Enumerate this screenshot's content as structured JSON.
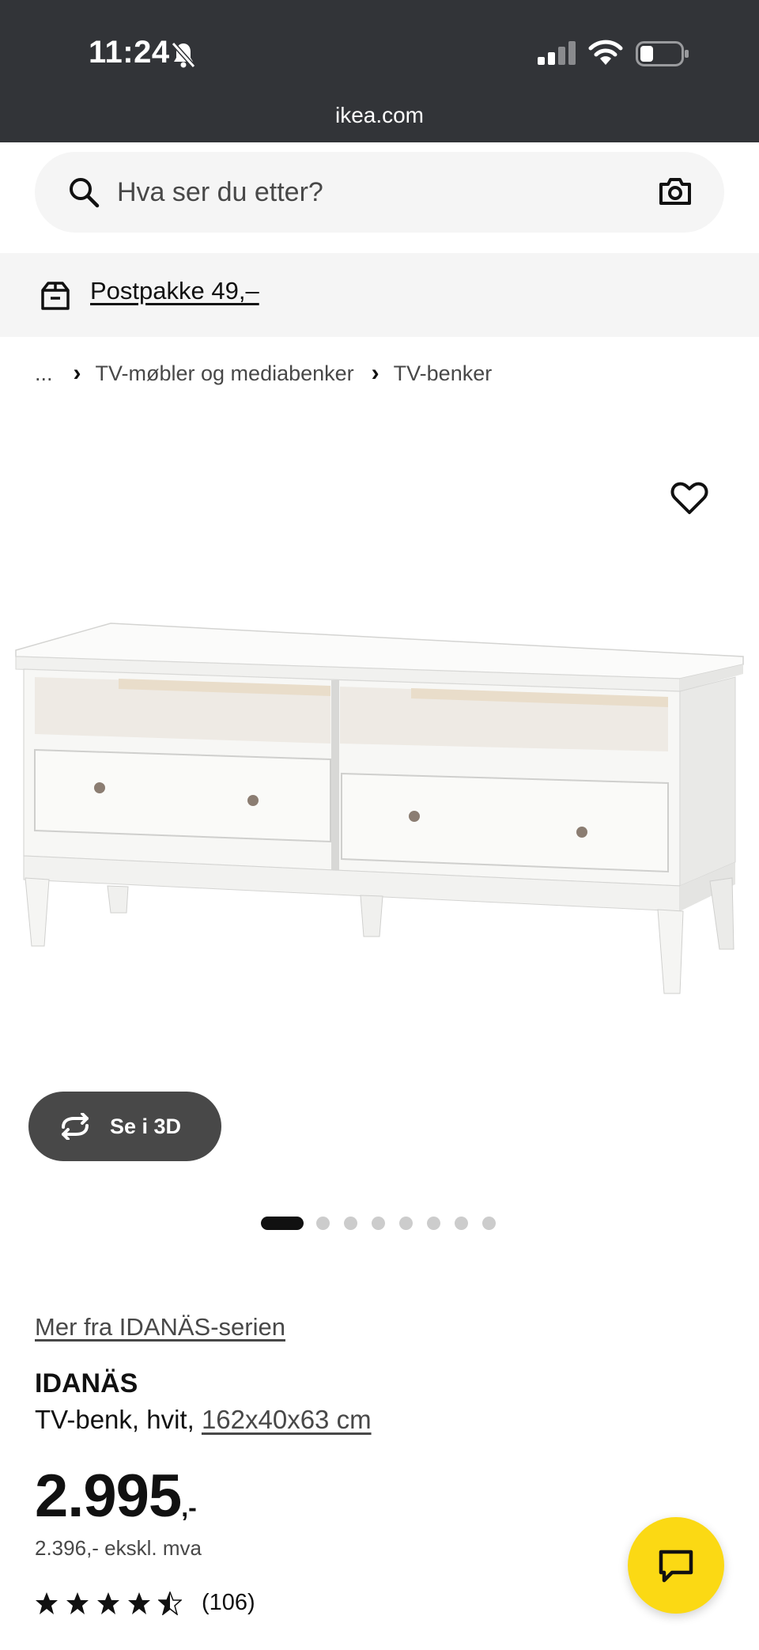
{
  "status_bar": {
    "time": "11:24",
    "icons": [
      "bell-slash-icon",
      "cellular-signal-icon",
      "wifi-icon",
      "battery-icon"
    ]
  },
  "browser": {
    "url": "ikea.com"
  },
  "search": {
    "placeholder": "Hva ser du etter?",
    "value": ""
  },
  "delivery": {
    "label": "Postpakke 49,–",
    "icon": "delivery-box-icon"
  },
  "breadcrumb": {
    "items": [
      "...",
      "TV-møbler og mediabenker",
      "TV-benker"
    ]
  },
  "gallery": {
    "view_3d_label": "Se i 3D",
    "dot_count": 8,
    "active_index": 0
  },
  "product": {
    "series_link": "Mer fra IDANÄS-serien",
    "name": "IDANÄS",
    "description": "TV-benk, hvit, ",
    "dimensions": "162x40x63 cm",
    "price_integer": "2.995",
    "price_suffix": ",-",
    "price_excl_vat": "2.396,- ekskl. mva",
    "rating": 4.5,
    "rating_max": 5,
    "review_count": "(106)"
  },
  "colors": {
    "status_bar_bg": "#323438",
    "chat_fab": "#fbd914",
    "button_dark": "#484848"
  }
}
